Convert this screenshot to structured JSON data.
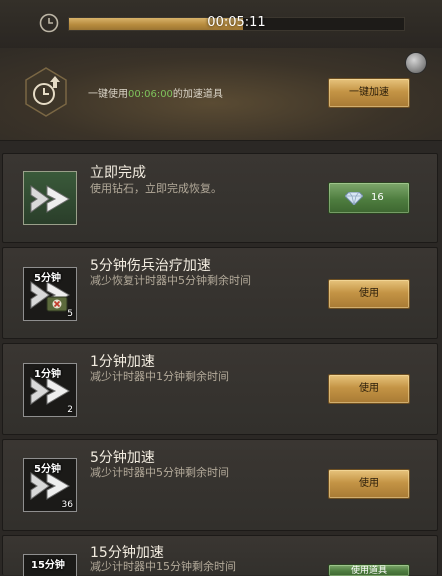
{
  "timer": {
    "time_remaining": "00:05:11",
    "progress": 0.52
  },
  "quick_speedup": {
    "desc_prefix": "一键使用",
    "desc_highlight": "00:06:00",
    "desc_suffix": "的加速道具",
    "button_label": "一键加速"
  },
  "instant": {
    "title": "立即完成",
    "desc": "使用钻石，立即完成恢复。",
    "gem_cost": "16"
  },
  "items": [
    {
      "title": "5分钟伤兵治疗加速",
      "desc": "减少恢复计时器中5分钟剩余时间",
      "icon_label": "5分钟",
      "count": "5",
      "button_label": "使用"
    },
    {
      "title": "1分钟加速",
      "desc": "减少计时器中1分钟剩余时间",
      "icon_label": "1分钟",
      "count": "2",
      "button_label": "使用"
    },
    {
      "title": "5分钟加速",
      "desc": "减少计时器中5分钟剩余时间",
      "icon_label": "5分钟",
      "count": "36",
      "button_label": "使用"
    },
    {
      "title": "15分钟加速",
      "desc": "减少计时器中15分钟剩余时间",
      "icon_label": "15分钟",
      "count": "",
      "button_label": "使用道具"
    }
  ],
  "colors": {
    "gold": "#c49445",
    "green": "#4e7d3f",
    "highlight": "#7fc35c"
  }
}
